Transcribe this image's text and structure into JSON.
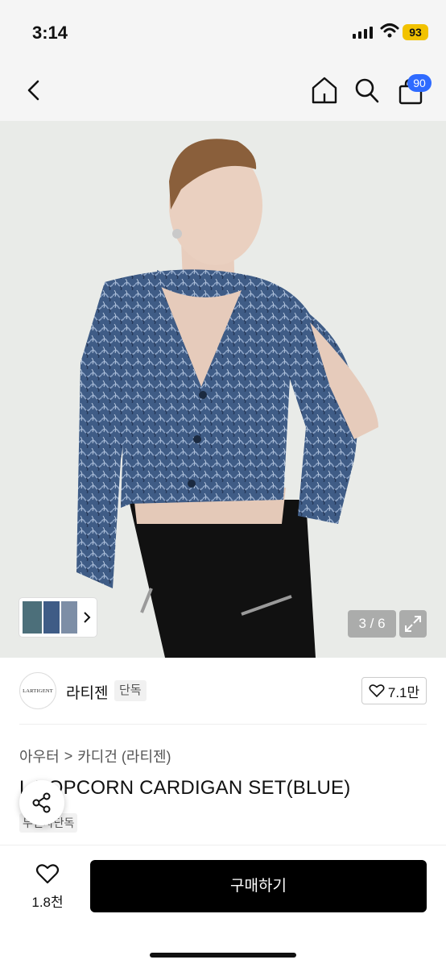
{
  "status": {
    "time": "3:14",
    "battery": "93"
  },
  "nav": {
    "back_icon": "chevron-left-icon",
    "home_icon": "home-icon",
    "search_icon": "search-icon",
    "cart_icon": "bag-icon",
    "cart_count": "90"
  },
  "gallery": {
    "pager": "3 / 6",
    "expand_icon": "expand-icon",
    "thumbs_arrow": "chevron-right-icon"
  },
  "brand": {
    "logo_text": "LARTIGENT",
    "name": "라티젠",
    "tag": "단독",
    "like_count": "7.1만"
  },
  "breadcrumb": {
    "level1": "아우터",
    "separator": ">",
    "level2": "카디건 (라티젠)"
  },
  "product": {
    "title": "L POPCORN CARDIGAN SET(BLUE)",
    "exclusive_tag": "무신사단독"
  },
  "bottom": {
    "wish_count": "1.8천",
    "buy_label": "구매하기"
  },
  "colors": {
    "cart_badge": "#2f6bff",
    "battery": "#f2c200",
    "buy_button": "#000000",
    "sweater": "#3f5c86"
  }
}
